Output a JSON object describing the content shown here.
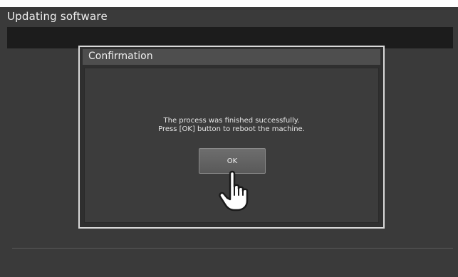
{
  "screen": {
    "title": "Updating software"
  },
  "dialog": {
    "title": "Confirmation",
    "message_line1": "The process was finished successfully.",
    "message_line2": "Press [OK] button to reboot the machine.",
    "ok_label": "OK"
  },
  "icons": {
    "pointer": "hand-pointer-icon"
  }
}
